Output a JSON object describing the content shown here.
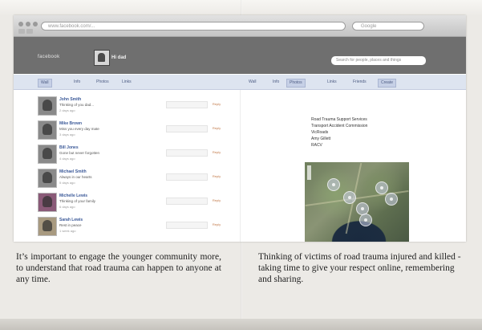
{
  "browser": {
    "url": "www.facebook.com/...",
    "search_placeholder": "Google"
  },
  "header": {
    "logo": "facebook",
    "page_name": "Hi dad",
    "search_placeholder": "Search for people, places and things"
  },
  "left_tabs": [
    "Wall",
    "Info",
    "Photos",
    "Links"
  ],
  "right_tabs": [
    "Wall",
    "Info",
    "Photos",
    "Links",
    "Friends",
    "Create"
  ],
  "posts": [
    {
      "name": "John Smith",
      "text": "Thinking of you dad...",
      "time": "2 days ago",
      "action": "Reply"
    },
    {
      "name": "Mike Brown",
      "text": "Miss you every day mate",
      "time": "3 days ago",
      "action": "Reply"
    },
    {
      "name": "Bill Jones",
      "text": "Gone but never forgotten",
      "time": "4 days ago",
      "action": "Reply"
    },
    {
      "name": "Michael Smith",
      "text": "Always in our hearts",
      "time": "5 days ago",
      "action": "Reply"
    },
    {
      "name": "Michelle Lewis",
      "text": "Thinking of your family",
      "time": "6 days ago",
      "action": "Reply"
    },
    {
      "name": "Sarah Lewis",
      "text": "Rest in peace",
      "time": "1 week ago",
      "action": "Reply"
    }
  ],
  "highlight_lines": [
    "Road Trauma Support Services",
    "Transport Accident Commission",
    "VicRoads",
    "Amy Gillett",
    "RACV"
  ],
  "captions": {
    "left": "It’s important to engage the younger community more, to understand that road trauma can happen to anyone at any time.",
    "right": "Thinking of victims of road trauma injured and killed - taking time to give your respect online, remembering and sharing."
  },
  "colors": {
    "accent": "#3b5998",
    "header": "#6f6f6f"
  }
}
